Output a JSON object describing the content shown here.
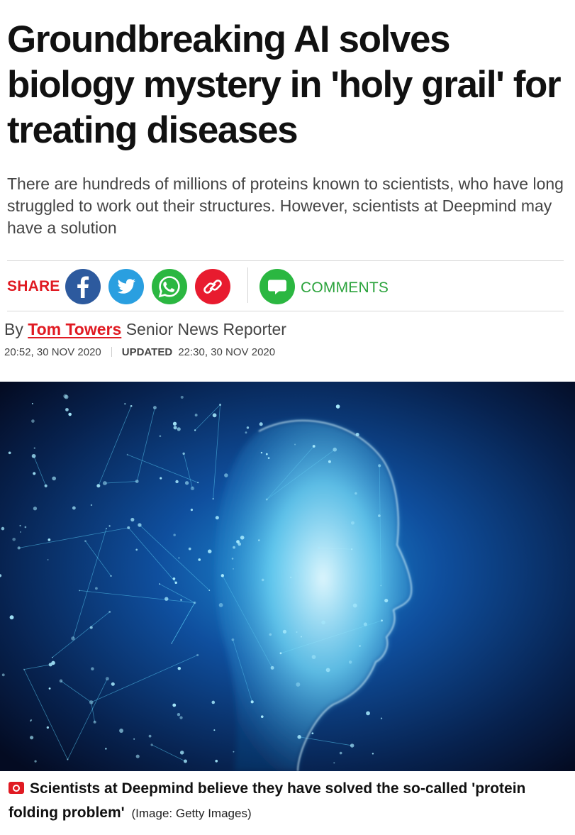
{
  "article": {
    "headline": "Groundbreaking AI solves biology mystery in 'holy grail' for treating diseases",
    "standfirst": "There are hundreds of millions of proteins known to scientists, who have long struggled to work out their structures. However, scientists at Deepmind may have a solution"
  },
  "share": {
    "label": "SHARE",
    "buttons": [
      {
        "icon": "facebook-icon",
        "color": "#2d5a9e"
      },
      {
        "icon": "twitter-icon",
        "color": "#2a9fe0"
      },
      {
        "icon": "whatsapp-icon",
        "color": "#2bb741"
      },
      {
        "icon": "link-icon",
        "color": "#e81b2f"
      }
    ],
    "comments_icon": "comment-bubble-icon",
    "comments_label": "COMMENTS"
  },
  "byline": {
    "prefix": "By",
    "author": "Tom Towers",
    "role": "Senior News Reporter",
    "published": "20:52, 30 NOV 2020",
    "updated_label": "UPDATED",
    "updated": "22:30, 30 NOV 2020"
  },
  "image": {
    "caption": "Scientists at Deepmind believe they have solved the so-called 'protein folding problem'",
    "credit": "(Image: Getty Images)",
    "caption_icon": "camera-icon"
  },
  "colors": {
    "accent": "#e01a22",
    "comments_green": "#2ba33c"
  }
}
